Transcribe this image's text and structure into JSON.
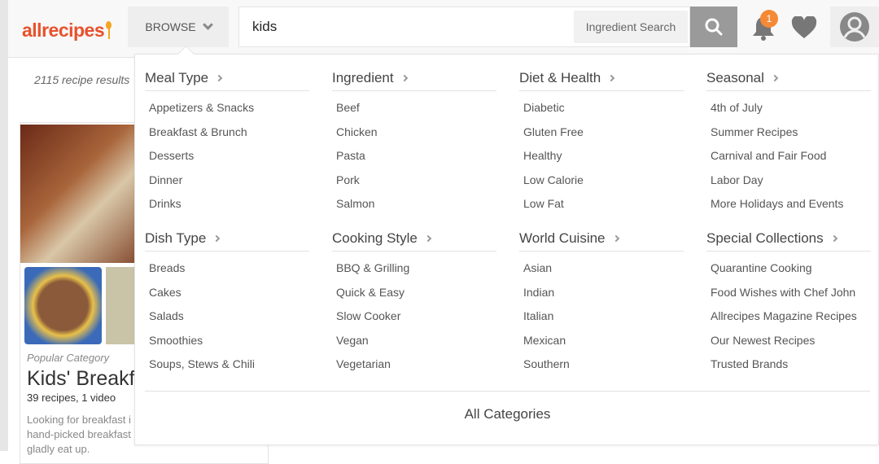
{
  "header": {
    "logo": "allrecipes",
    "browse_label": "BROWSE",
    "search_value": "kids",
    "ingredient_search_label": "Ingredient Search",
    "notification_count": "1"
  },
  "results": {
    "count_text": "2115 recipe results"
  },
  "card": {
    "kicker": "Popular Category",
    "title": "Kids' Breakfast",
    "meta": "39 recipes, 1 video",
    "desc_line1": "Looking for breakfast i",
    "desc_line2": "hand-picked breakfast",
    "desc_line3": "gladly eat up."
  },
  "menu": {
    "sections": [
      {
        "title": "Meal Type",
        "items": [
          "Appetizers & Snacks",
          "Breakfast & Brunch",
          "Desserts",
          "Dinner",
          "Drinks"
        ]
      },
      {
        "title": "Ingredient",
        "items": [
          "Beef",
          "Chicken",
          "Pasta",
          "Pork",
          "Salmon"
        ]
      },
      {
        "title": "Diet & Health",
        "items": [
          "Diabetic",
          "Gluten Free",
          "Healthy",
          "Low Calorie",
          "Low Fat"
        ]
      },
      {
        "title": "Seasonal",
        "items": [
          "4th of July",
          "Summer Recipes",
          "Carnival and Fair Food",
          "Labor Day",
          "More Holidays and Events"
        ]
      },
      {
        "title": "Dish Type",
        "items": [
          "Breads",
          "Cakes",
          "Salads",
          "Smoothies",
          "Soups, Stews & Chili"
        ]
      },
      {
        "title": "Cooking Style",
        "items": [
          "BBQ & Grilling",
          "Quick & Easy",
          "Slow Cooker",
          "Vegan",
          "Vegetarian"
        ]
      },
      {
        "title": "World Cuisine",
        "items": [
          "Asian",
          "Indian",
          "Italian",
          "Mexican",
          "Southern"
        ]
      },
      {
        "title": "Special Collections",
        "items": [
          "Quarantine Cooking",
          "Food Wishes with Chef John",
          "Allrecipes Magazine Recipes",
          "Our Newest Recipes",
          "Trusted Brands"
        ]
      }
    ],
    "all_categories": "All Categories"
  },
  "colors": {
    "brand": "#e8512c",
    "badge": "#f58a36",
    "search_button": "#9a9a9a"
  }
}
